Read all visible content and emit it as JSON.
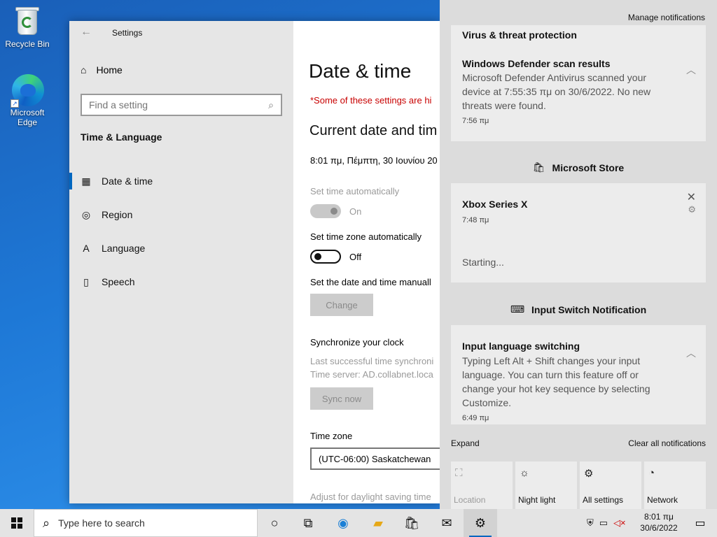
{
  "desktop": {
    "icons": [
      {
        "label": "Recycle Bin"
      },
      {
        "label": "Microsoft Edge"
      }
    ]
  },
  "settings": {
    "window_title": "Settings",
    "nav": {
      "home": "Home",
      "search_placeholder": "Find a setting",
      "section": "Time & Language",
      "items": [
        {
          "label": "Date & time",
          "icon": "calendar-clock-icon",
          "active": true
        },
        {
          "label": "Region",
          "icon": "globe-icon"
        },
        {
          "label": "Language",
          "icon": "language-icon"
        },
        {
          "label": "Speech",
          "icon": "microphone-icon"
        }
      ]
    },
    "content": {
      "title": "Date & time",
      "warning": "*Some of these settings are hi",
      "section_title": "Current date and tim",
      "current_time": "8:01 πμ, Πέμπτη, 30 Ιουνίου 20",
      "set_time_auto": {
        "label": "Set time automatically",
        "state": "On"
      },
      "set_tz_auto": {
        "label": "Set time zone automatically",
        "state": "Off"
      },
      "manual": {
        "label": "Set the date and time manuall",
        "button": "Change"
      },
      "sync": {
        "title": "Synchronize your clock",
        "last": "Last successful time synchroni",
        "server": "Time server: AD.collabnet.loca",
        "button": "Sync now"
      },
      "timezone": {
        "label": "Time zone",
        "value": "(UTC-06:00) Saskatchewan"
      },
      "daylight": "Adjust for daylight saving time"
    }
  },
  "action_center": {
    "manage": "Manage notifications",
    "defender": {
      "group": "Virus & threat protection",
      "title": "Windows Defender scan results",
      "body": "Microsoft Defender Antivirus scanned your device at 7:55:35 πμ on 30/6/2022. No new threats were found.",
      "time": "7:56 πμ"
    },
    "store": {
      "app": "Microsoft Store",
      "title": "Xbox Series X",
      "time": "7:48 πμ",
      "status": "Starting..."
    },
    "input": {
      "app": "Input Switch Notification",
      "title": "Input language switching",
      "body": "Typing Left Alt + Shift changes your input language. You can turn this feature off or change your hot key sequence by selecting Customize.",
      "time": "6:49 πμ"
    },
    "expand": "Expand",
    "clear_all": "Clear all notifications",
    "quick_actions": [
      {
        "label": "Location",
        "icon": "location-icon",
        "enabled": false
      },
      {
        "label": "Night light",
        "icon": "brightness-icon",
        "enabled": true
      },
      {
        "label": "All settings",
        "icon": "gear-icon",
        "enabled": true
      },
      {
        "label": "Network",
        "icon": "network-icon",
        "enabled": true
      }
    ]
  },
  "taskbar": {
    "search_placeholder": "Type here to search",
    "clock_time": "8:01 πμ",
    "clock_date": "30/6/2022"
  },
  "colors": {
    "accent": "#0067c0",
    "warning": "#c80000"
  }
}
